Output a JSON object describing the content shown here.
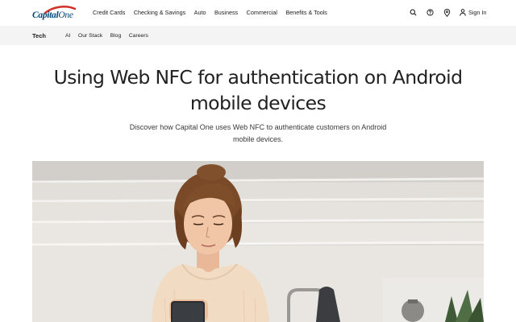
{
  "brand": {
    "logo_text_main": "Capital",
    "logo_text_accent": "One"
  },
  "nav": {
    "items": [
      "Credit Cards",
      "Checking & Savings",
      "Auto",
      "Business",
      "Commercial",
      "Benefits & Tools"
    ],
    "signin_label": "Sign In",
    "icons": [
      "search-icon",
      "help-icon",
      "location-icon",
      "user-icon"
    ]
  },
  "subnav": {
    "section": "Tech",
    "items": [
      "AI",
      "Our Stack",
      "Blog",
      "Careers"
    ]
  },
  "article": {
    "title": "Using Web NFC for authentication on Android mobile devices",
    "subtitle": "Discover how Capital One uses Web NFC to authenticate customers on Android mobile devices."
  },
  "colors": {
    "brand_blue": "#004879",
    "brand_red": "#d03027",
    "subnav_bg": "#f4f4f4"
  }
}
